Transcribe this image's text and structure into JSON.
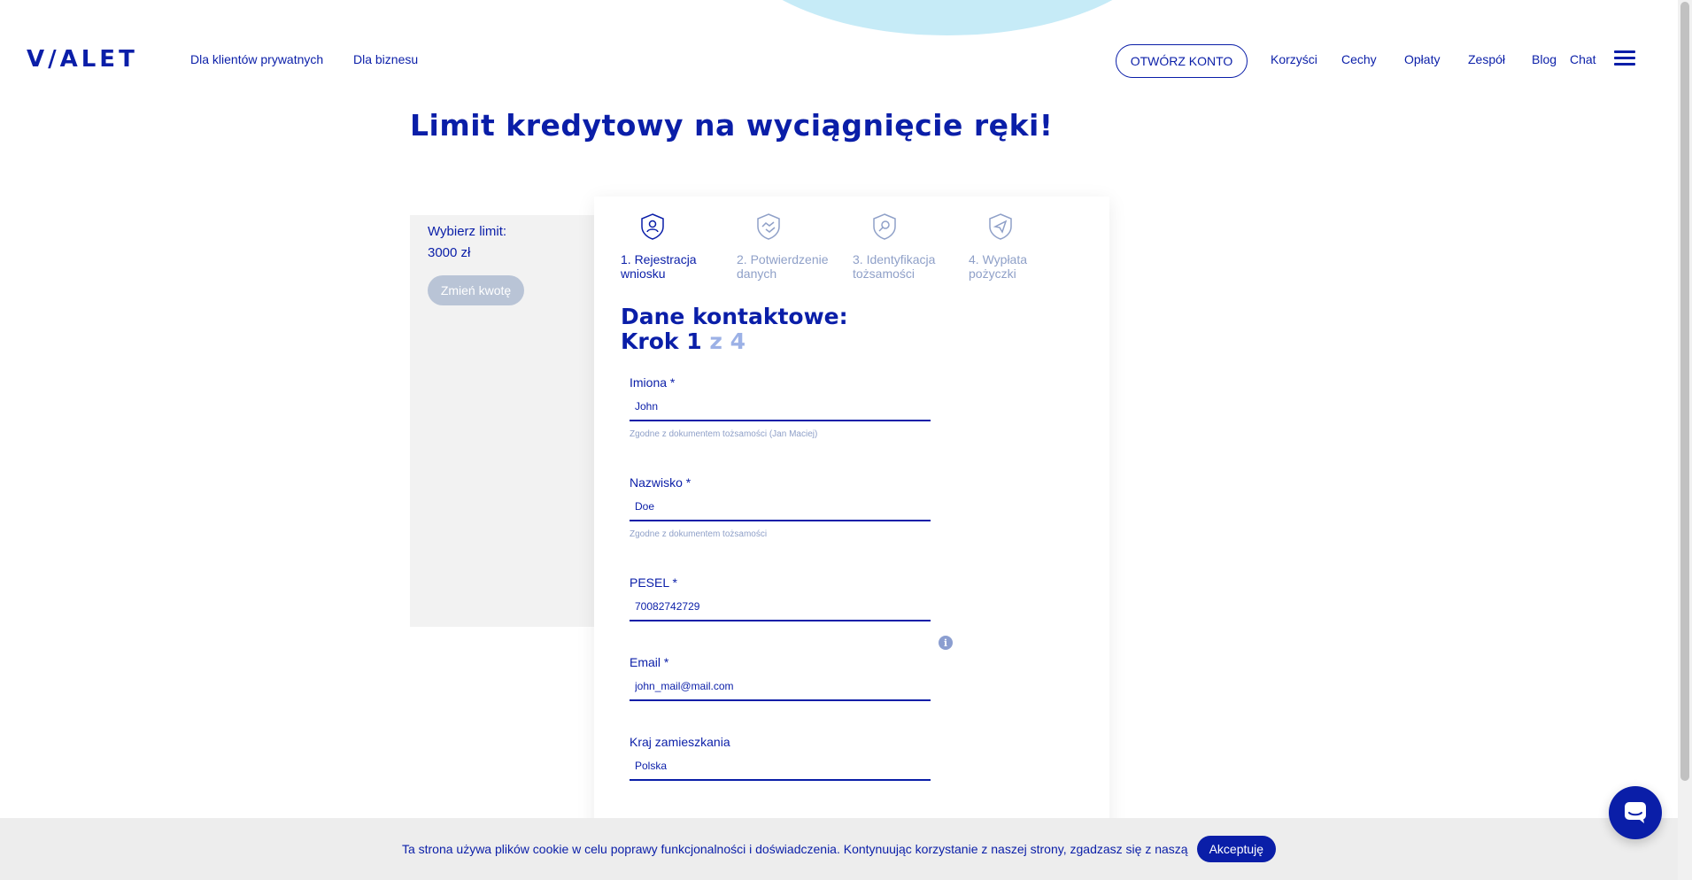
{
  "header": {
    "logo": "V/ALET",
    "nav_left": [
      "Dla klientów prywatnych",
      "Dla biznesu"
    ],
    "open_account": "OTWÓRZ KONTO",
    "nav_right": [
      "Korzyści",
      "Cechy",
      "Opłaty",
      "Zespół",
      "Blog",
      "Chat"
    ]
  },
  "main": {
    "title": "Limit kredytowy na wyciągnięcie ręki!"
  },
  "side_panel": {
    "label": "Wybierz limit:",
    "amount": "3000 zł",
    "change_button": "Zmień kwotę"
  },
  "steps": [
    {
      "label": "1. Rejestracja wniosku",
      "icon": "user-shield-icon",
      "active": true
    },
    {
      "label": "2. Potwierdzenie danych",
      "icon": "handshake-shield-icon",
      "active": false
    },
    {
      "label": "3. Identyfikacja tożsamości",
      "icon": "search-shield-icon",
      "active": false
    },
    {
      "label": "4. Wypłata pożyczki",
      "icon": "send-shield-icon",
      "active": false
    }
  ],
  "form": {
    "section_title": "Dane kontaktowe:",
    "step_prefix": "Krok 1",
    "step_total": "z 4",
    "fields": [
      {
        "label": "Imiona *",
        "value": "John",
        "hint": "Zgodne z dokumentem tożsamości (Jan Maciej)"
      },
      {
        "label": "Nazwisko *",
        "value": "Doe",
        "hint": "Zgodne z dokumentem tożsamości"
      },
      {
        "label": "PESEL *",
        "value": "70082742729",
        "hint": ""
      },
      {
        "label": "Email *",
        "value": "john_mail@mail.com",
        "hint": ""
      },
      {
        "label": "Kraj zamieszkania",
        "value": "Polska",
        "hint": ""
      }
    ],
    "info_icon": "i"
  },
  "cookie": {
    "text": "Ta strona używa plików cookie w celu poprawy funkcjonalności i doświadczenia. Kontynuując korzystanie z naszej strony, zgadzasz się z naszą",
    "accept": "Akceptuję"
  },
  "colors": {
    "brand": "#0a1ea8",
    "muted": "#8fa0c8",
    "panel": "#f2f2f2",
    "wave": "#c6ebf7"
  }
}
